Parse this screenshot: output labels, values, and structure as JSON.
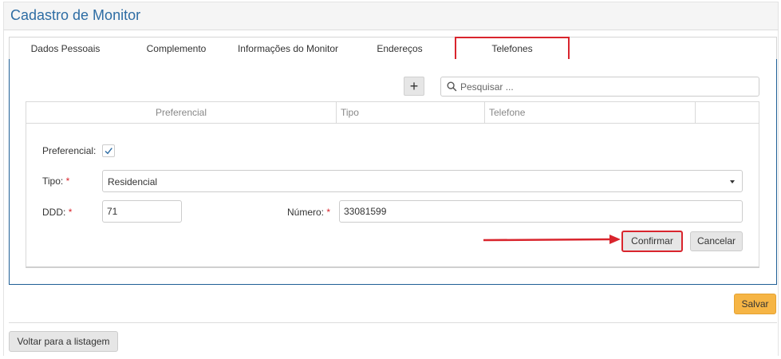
{
  "page": {
    "title": "Cadastro de Monitor"
  },
  "tabs": [
    {
      "label": "Dados Pessoais"
    },
    {
      "label": "Complemento"
    },
    {
      "label": "Informações do Monitor"
    },
    {
      "label": "Endereços"
    },
    {
      "label": "Telefones",
      "active": true
    }
  ],
  "toolbar": {
    "add_icon": "plus-icon",
    "add_label": "+",
    "search_placeholder": "Pesquisar ...",
    "search_icon": "search-icon"
  },
  "grid": {
    "columns": [
      "Preferencial",
      "Tipo",
      "Telefone",
      ""
    ]
  },
  "form": {
    "preferencial_label": "Preferencial:",
    "preferencial_checked": true,
    "tipo_label": "Tipo:",
    "tipo_value": "Residencial",
    "ddd_label": "DDD:",
    "ddd_value": "71",
    "numero_label": "Número:",
    "numero_value": "33081599",
    "required_mark": "*",
    "confirm_label": "Confirmar",
    "cancel_label": "Cancelar"
  },
  "footer": {
    "save_label": "Salvar",
    "back_label": "Voltar para a listagem"
  },
  "colors": {
    "accent": "#1f5f96",
    "highlight": "#d9252d",
    "save": "#f6b545",
    "required": "#d9252d"
  }
}
